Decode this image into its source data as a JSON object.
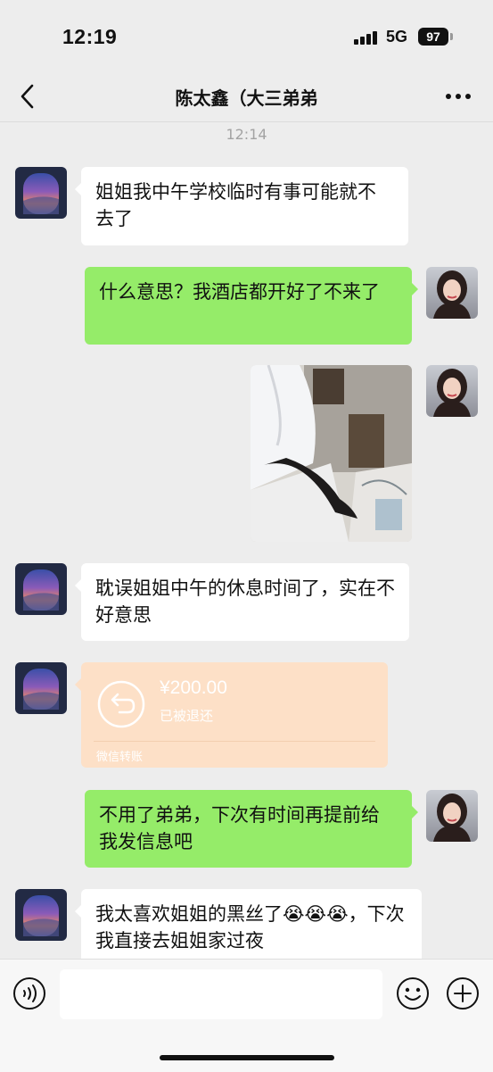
{
  "status_bar": {
    "time": "12:19",
    "network": "5G",
    "battery": "97"
  },
  "nav": {
    "title": "陈太鑫（大三弟弟"
  },
  "chat": {
    "timestamp": "12:14",
    "messages": [
      {
        "side": "in",
        "type": "text",
        "text": "姐姐我中午学校临时有事可能就不去了"
      },
      {
        "side": "out",
        "type": "text",
        "text": "什么意思？我酒店都开好了不来了"
      },
      {
        "side": "out",
        "type": "image"
      },
      {
        "side": "in",
        "type": "text",
        "text": "耽误姐姐中午的休息时间了，实在不好意思"
      },
      {
        "side": "in",
        "type": "transfer",
        "amount": "¥200.00",
        "status": "已被退还",
        "footer": "微信转账"
      },
      {
        "side": "out",
        "type": "text",
        "text": "不用了弟弟，下次有时间再提前给我发信息吧"
      },
      {
        "side": "in",
        "type": "text",
        "text": "我太喜欢姐姐的黑丝了😭😭😭，下次我直接去姐姐家过夜"
      }
    ]
  },
  "input_bar": {
    "value": ""
  },
  "icons": [
    "back-icon",
    "more-icon",
    "voice-icon",
    "emoji-icon",
    "plus-icon",
    "transfer-return-icon"
  ],
  "colors": {
    "background": "#ededed",
    "outgoing_bubble": "#95ec69",
    "incoming_bubble": "#ffffff",
    "transfer_card": "#fde0c7"
  }
}
